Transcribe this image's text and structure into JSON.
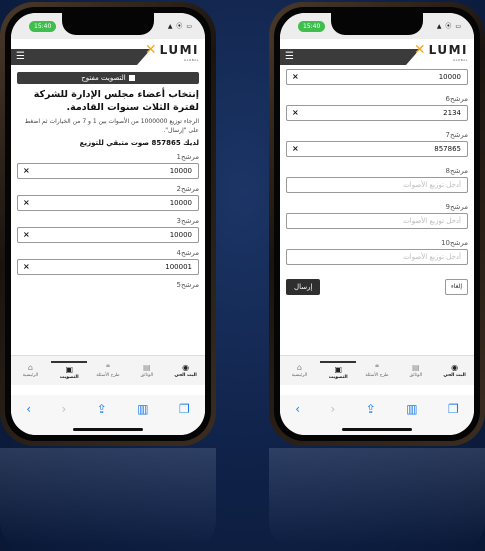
{
  "status": {
    "time": "15:40",
    "icons": "▲ ⦿ ▭"
  },
  "brand": {
    "name": "LUMI",
    "sub": "GLOBAL",
    "accent": "#f0a81e"
  },
  "left": {
    "poll_label": "التصويت مفتوح",
    "question": "إنتخاب أعضاء مجلس الإدارة للشركة لفترة الثلاث سنوات القادمة.",
    "instructions": "الرجاء توزيع 1000000 من الأصوات بين 1 و 7 من الخيارات ثم اضغط على \"إرسال\".",
    "remaining": "لديك 857865 صوت متبقي للتوزيع",
    "candidates": [
      {
        "label": "مرشح1",
        "value": "10000"
      },
      {
        "label": "مرشح2",
        "value": "10000"
      },
      {
        "label": "مرشح3",
        "value": "10000"
      },
      {
        "label": "مرشح4",
        "value": "100001"
      }
    ],
    "next_label": "مرشح5"
  },
  "right": {
    "candidates": [
      {
        "label": "",
        "value": "10000"
      },
      {
        "label": "مرشح6",
        "value": "2134"
      },
      {
        "label": "مرشح7",
        "value": "857865"
      },
      {
        "label": "مرشح8",
        "value": "",
        "placeholder": "أدخل توزيع الأصوات"
      },
      {
        "label": "مرشح9",
        "value": "",
        "placeholder": "أدخل توزيع الأصوات"
      },
      {
        "label": "مرشح10",
        "value": "",
        "placeholder": "أدخل توزيع الأصوات"
      }
    ],
    "send_label": "إرسال",
    "cancel_label": "إلغاء"
  },
  "nav": {
    "home": "الرئيسية",
    "voting": "التصويت",
    "ask": "طرح الأسئلة",
    "docs": "الوثائق",
    "live": "البث الحي"
  },
  "clear_symbol": "×"
}
